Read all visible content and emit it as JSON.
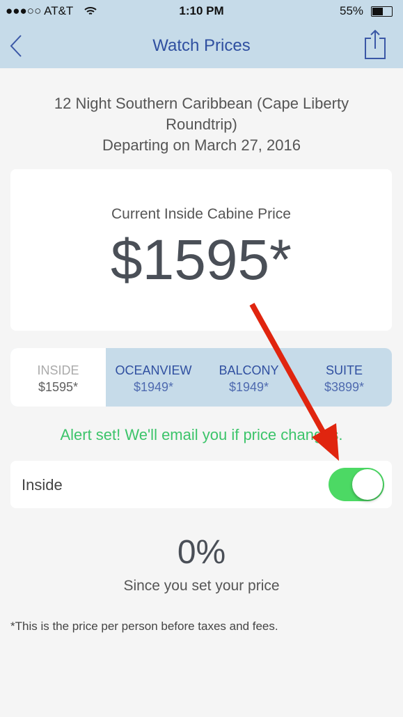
{
  "status_bar": {
    "carrier": "●●●○○ AT&T",
    "time": "1:10 PM",
    "battery": "55%"
  },
  "nav": {
    "title": "Watch Prices",
    "back_icon": "chevron-left-icon",
    "share_icon": "share-icon"
  },
  "trip": {
    "line1": "12 Night Southern Caribbean (Cape Liberty",
    "line2": "Roundtrip)",
    "line3": "Departing on March 27, 2016"
  },
  "price_card": {
    "label": "Current Inside Cabine Price",
    "price": "$1595*"
  },
  "cabins": [
    {
      "name": "INSIDE",
      "price": "$1595*",
      "selected": true
    },
    {
      "name": "OCEANVIEW",
      "price": "$1949*"
    },
    {
      "name": "BALCONY",
      "price": "$1949*"
    },
    {
      "name": "SUITE",
      "price": "$3899*"
    }
  ],
  "alert": {
    "message": "Alert set! We'll email you if price changes.",
    "color": "#3cc46a"
  },
  "toggle_row": {
    "label": "Inside",
    "on": true
  },
  "change": {
    "value": "0%",
    "caption": "Since you set your price"
  },
  "footnote": "*This is the price per person before taxes and fees.",
  "annotation": {
    "arrow_color": "#e0250f"
  }
}
